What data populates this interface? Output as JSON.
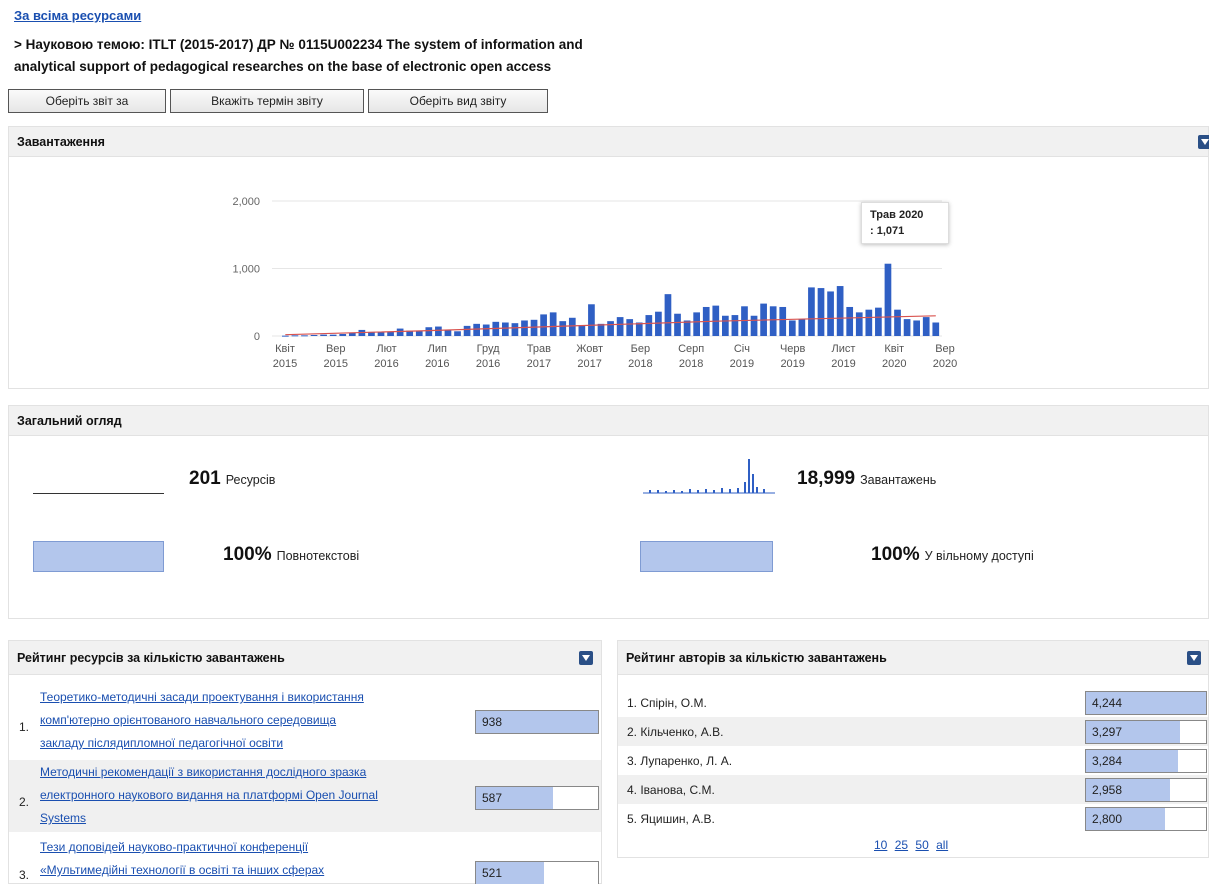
{
  "breadcrumb": {
    "link": "За всіма ресурсами"
  },
  "subtitle": {
    "line1": "> Науковою темою: ITLT (2015-2017) ДР № 0115U002234 The system of information and",
    "line2": "analytical support of pedagogical researches on the base of electronic open access"
  },
  "buttons": {
    "report_for": "Оберіть звіт за",
    "report_term": "Вкажіть термін звіту",
    "report_type": "Оберіть вид звіту"
  },
  "downloads": {
    "title": "Завантаження",
    "tooltip": {
      "label": "Трав 2020",
      "value": ": 1,071"
    }
  },
  "chart_data": {
    "type": "bar",
    "ylim": [
      0,
      2000
    ],
    "yticks": [
      "2,000",
      "1,000",
      "0"
    ],
    "xticks": [
      {
        "m": "Квіт",
        "y": "2015"
      },
      {
        "m": "Вер",
        "y": "2015"
      },
      {
        "m": "Лют",
        "y": "2016"
      },
      {
        "m": "Лип",
        "y": "2016"
      },
      {
        "m": "Груд",
        "y": "2016"
      },
      {
        "m": "Трав",
        "y": "2017"
      },
      {
        "m": "Жовт",
        "y": "2017"
      },
      {
        "m": "Бер",
        "y": "2018"
      },
      {
        "m": "Серп",
        "y": "2018"
      },
      {
        "m": "Січ",
        "y": "2019"
      },
      {
        "m": "Черв",
        "y": "2019"
      },
      {
        "m": "Лист",
        "y": "2019"
      },
      {
        "m": "Квіт",
        "y": "2020"
      },
      {
        "m": "Вер",
        "y": "2020"
      }
    ],
    "values": [
      5,
      10,
      10,
      15,
      20,
      20,
      30,
      50,
      90,
      60,
      55,
      60,
      110,
      80,
      70,
      130,
      140,
      90,
      70,
      150,
      180,
      170,
      210,
      200,
      190,
      230,
      240,
      320,
      350,
      220,
      270,
      160,
      470,
      180,
      220,
      280,
      250,
      200,
      310,
      360,
      620,
      330,
      230,
      350,
      430,
      450,
      300,
      310,
      440,
      300,
      480,
      440,
      430,
      230,
      250,
      720,
      710,
      660,
      740,
      430,
      350,
      390,
      420,
      1071,
      390,
      250,
      230,
      280,
      200
    ],
    "trend": [
      {
        "i": 0,
        "v": 20
      },
      {
        "i": 15,
        "v": 80
      },
      {
        "i": 30,
        "v": 150
      },
      {
        "i": 45,
        "v": 220
      },
      {
        "i": 68,
        "v": 300
      }
    ]
  },
  "overview": {
    "title": "Загальний огляд",
    "resources_num": "201",
    "resources_label": "Ресурсів",
    "downloads_num": "18,999",
    "downloads_label": "Завантажень",
    "fulltext_num": "100%",
    "fulltext_label": "Повнотекстові",
    "open_num": "100%",
    "open_label": "У вільному доступі"
  },
  "resources": {
    "title": "Рейтинг ресурсів за кількістю завантажень",
    "items": [
      {
        "idx": "1.",
        "line1": "Теоретико-методичні засади проектування і використання",
        "line2": "комп'ютерно орієнтованого навчального середовища",
        "line3": "закладу післядипломної педагогічної освіти",
        "value": "938",
        "fill": 1.0
      },
      {
        "idx": "2.",
        "line1": "Методичні рекомендації з використання дослідного зразка",
        "line2": "електронного наукового видання на платформі Open Journal",
        "line3": "Systems",
        "value": "587",
        "fill": 0.63
      },
      {
        "idx": "3.",
        "line1": "Тези доповідей науково-практичної конференції",
        "line2": "«Мультимедійні технології в освіті та інших сферах",
        "line3": "",
        "value": "521",
        "fill": 0.56
      }
    ]
  },
  "authors": {
    "title": "Рейтинг авторів за кількістю завантажень",
    "items": [
      {
        "name": "1.  Спірін, О.М.",
        "value": "4,244",
        "fill": 1.0
      },
      {
        "name": "2.  Кільченко, А.В.",
        "value": "3,297",
        "fill": 0.78
      },
      {
        "name": "3.  Лупаренко, Л. А.",
        "value": "3,284",
        "fill": 0.77
      },
      {
        "name": "4.  Іванова, С.М.",
        "value": "2,958",
        "fill": 0.7
      },
      {
        "name": "5.  Яцишин, А.В.",
        "value": "2,800",
        "fill": 0.66
      }
    ],
    "pager": [
      "10",
      "25",
      "50",
      "all"
    ]
  },
  "colors": {
    "bar": "#2f5fc4",
    "trend": "#d9534f",
    "fill": "#b3c6ec",
    "link": "#1a4fb0"
  }
}
